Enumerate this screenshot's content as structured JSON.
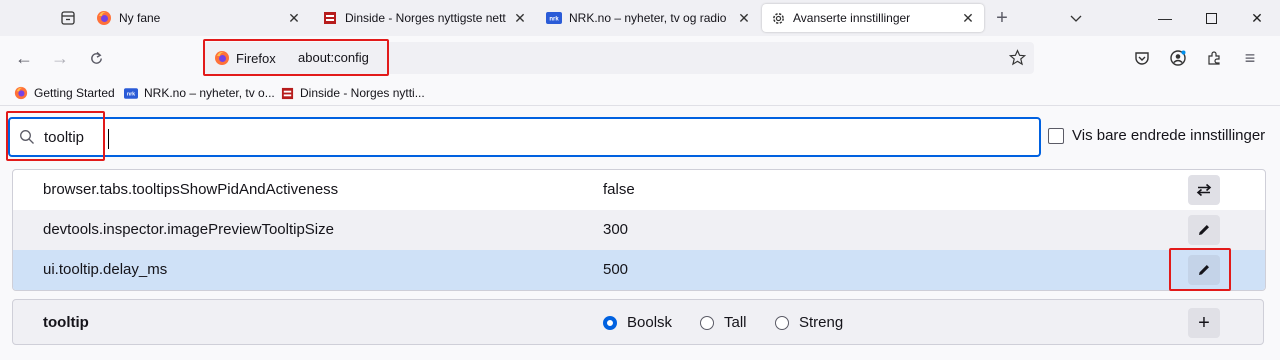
{
  "tabs": [
    {
      "title": "Ny fane",
      "icon": "firefox-icon"
    },
    {
      "title": "Dinside - Norges nyttigste netts",
      "icon": "dinside-icon"
    },
    {
      "title": "NRK.no – nyheter, tv og radio fr",
      "icon": "nrk-icon"
    },
    {
      "title": "Avanserte innstillinger",
      "icon": "gear-icon"
    }
  ],
  "nav": {
    "identity_label": "Firefox",
    "url": "about:config"
  },
  "bookmarks": [
    {
      "label": "Getting Started",
      "icon": "firefox-icon"
    },
    {
      "label": "NRK.no – nyheter, tv o...",
      "icon": "nrk-icon"
    },
    {
      "label": "Dinside - Norges nytti...",
      "icon": "dinside-icon"
    }
  ],
  "search": {
    "value": "tooltip",
    "show_modified_label": "Vis bare endrede innstillinger"
  },
  "prefs": [
    {
      "name": "browser.tabs.tooltipsShowPidAndActiveness",
      "value": "false",
      "action": "toggle"
    },
    {
      "name": "devtools.inspector.imagePreviewTooltipSize",
      "value": "300",
      "action": "edit"
    },
    {
      "name": "ui.tooltip.delay_ms",
      "value": "500",
      "action": "edit"
    }
  ],
  "add_row": {
    "name": "tooltip",
    "types": [
      "Boolsk",
      "Tall",
      "Streng"
    ],
    "selected_type": "Boolsk"
  },
  "colors": {
    "accent": "#0061e0",
    "highlight": "#e21a1a",
    "selected_row": "#cfe1f7"
  }
}
